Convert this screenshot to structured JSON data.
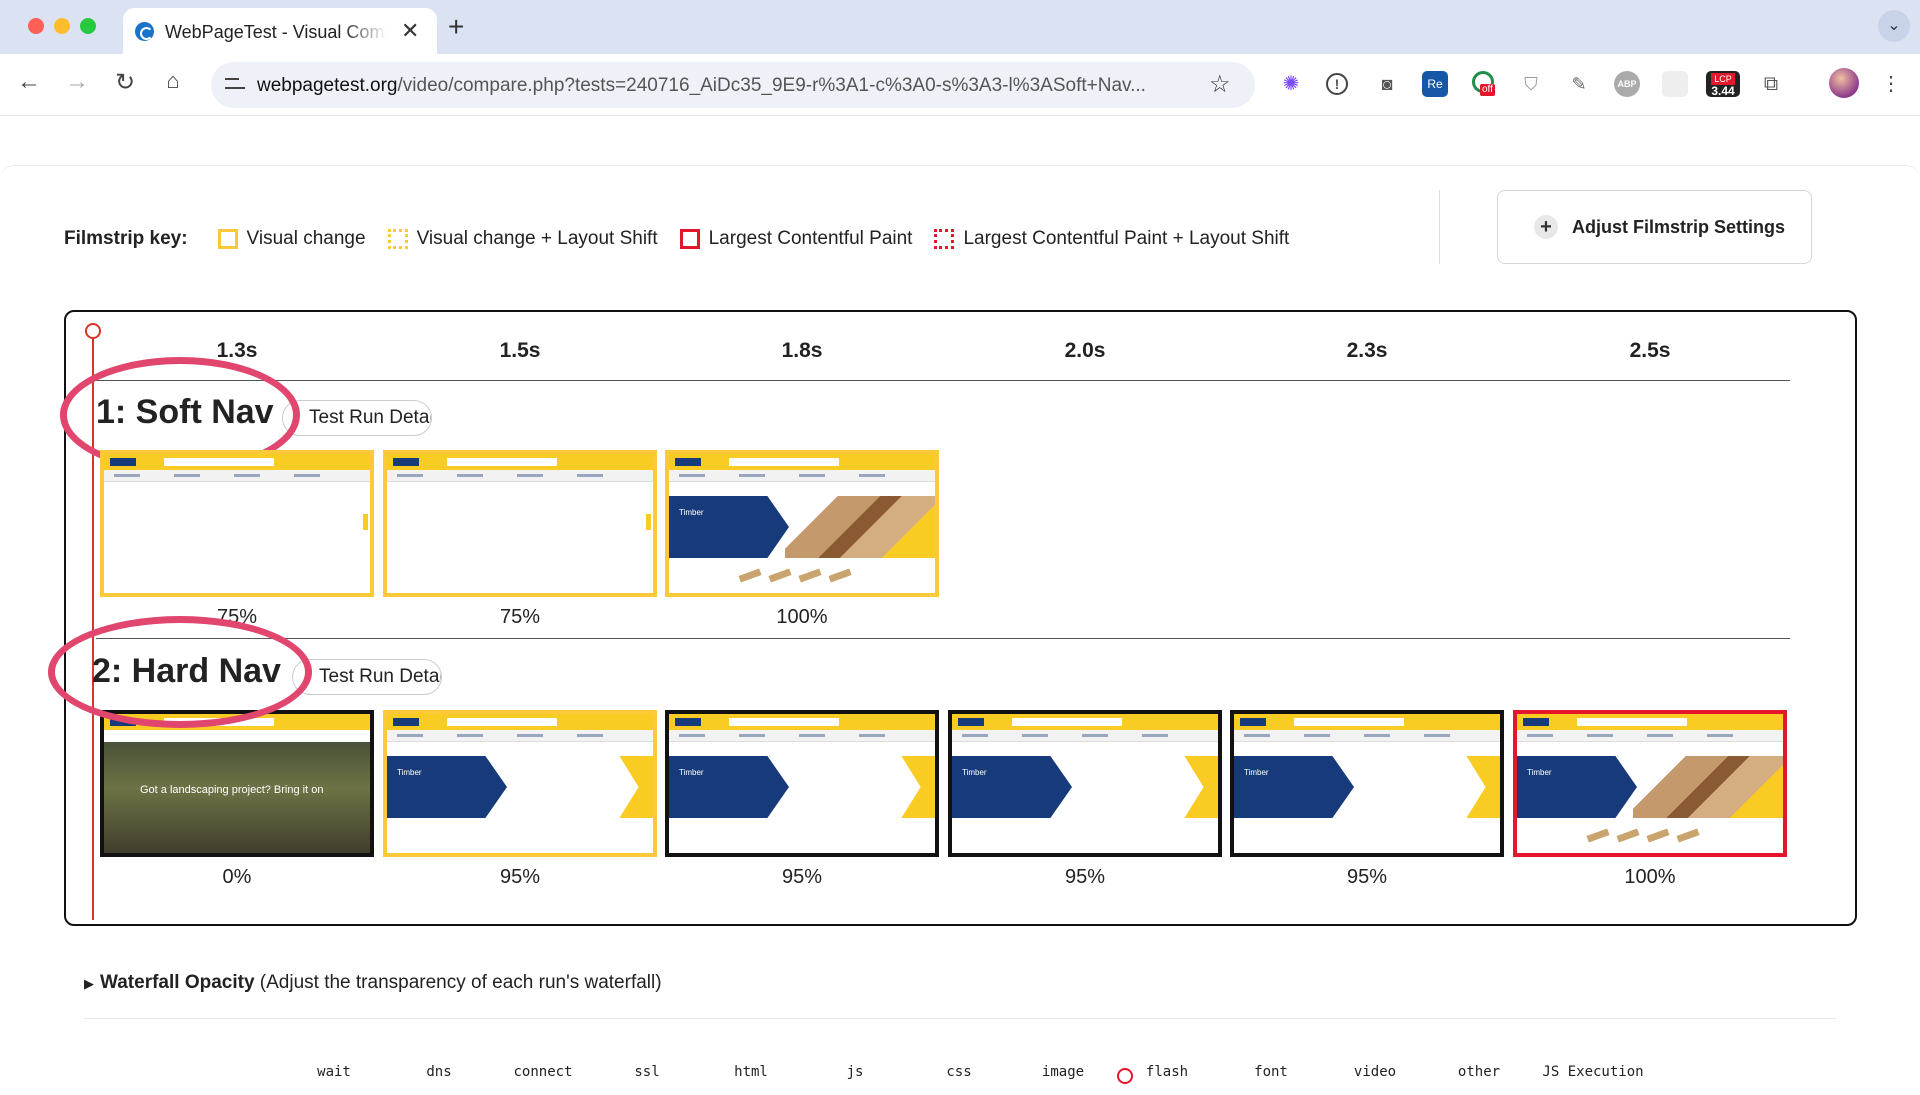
{
  "browser": {
    "tab_title": "WebPageTest - Visual Compa",
    "url_host": "webpagetest.org",
    "url_path": "/video/compare.php?tests=240716_AiDc35_9E9-r%3A1-c%3A0-s%3A3-l%3ASoft+Nav...",
    "extension_badges": {
      "off": "off",
      "lcp": "LCP",
      "lcp_value": "3.44",
      "adblock": "ABP",
      "readability": "Re"
    }
  },
  "filmstrip_key": {
    "title": "Filmstrip key:",
    "items": [
      {
        "label": "Visual change"
      },
      {
        "label": "Visual change + Layout Shift"
      },
      {
        "label": "Largest Contentful Paint"
      },
      {
        "label": "Largest Contentful Paint + Layout Shift"
      }
    ]
  },
  "settings_button": {
    "label": "Adjust Filmstrip Settings"
  },
  "times": [
    "1.3s",
    "1.5s",
    "1.8s",
    "2.0s",
    "2.3s",
    "2.5s"
  ],
  "runs": [
    {
      "label": "1: Soft Nav",
      "details": "Test Run Details",
      "frames": [
        {
          "progress": "75%",
          "border": "visual-change"
        },
        {
          "progress": "75%",
          "border": "visual-change"
        },
        {
          "progress": "100%",
          "border": "visual-change",
          "caption": "Timber"
        }
      ]
    },
    {
      "label": "2: Hard Nav",
      "details": "Test Run Details",
      "frames": [
        {
          "progress": "0%",
          "border": "none",
          "caption": "Got a landscaping project? Bring it on"
        },
        {
          "progress": "95%",
          "border": "visual-change",
          "caption": "Timber"
        },
        {
          "progress": "95%",
          "border": "none",
          "caption": "Timber"
        },
        {
          "progress": "95%",
          "border": "none",
          "caption": "Timber"
        },
        {
          "progress": "95%",
          "border": "none",
          "caption": "Timber"
        },
        {
          "progress": "100%",
          "border": "largest-contentful-paint",
          "caption": "Timber"
        }
      ]
    }
  ],
  "waterfall_opacity": {
    "title": "Waterfall Opacity",
    "description": "(Adjust the transparency of each run's waterfall)"
  },
  "waterfall_legend": [
    "wait",
    "dns",
    "connect",
    "ssl",
    "html",
    "js",
    "css",
    "image",
    "flash",
    "font",
    "video",
    "other",
    "JS Execution"
  ],
  "colors": {
    "visual_change": "#fcc93a",
    "lcp": "#e3162b",
    "annotation": "#e0466e",
    "playhead": "#d9342b"
  }
}
